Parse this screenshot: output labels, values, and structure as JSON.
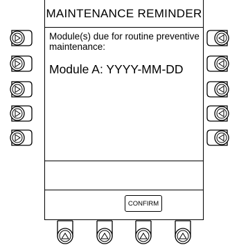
{
  "screen": {
    "title": "MAINTENANCE REMINDER",
    "message": "Module(s) due for routine preventive maintenance:",
    "module_line": "Module A:  YYYY-MM-DD"
  },
  "softkeys": {
    "confirm_label": "CONFIRM"
  },
  "icons": {
    "left_keys": "triangle-right-icon",
    "right_keys": "triangle-left-icon",
    "bottom_keys": "triangle-up-icon"
  }
}
